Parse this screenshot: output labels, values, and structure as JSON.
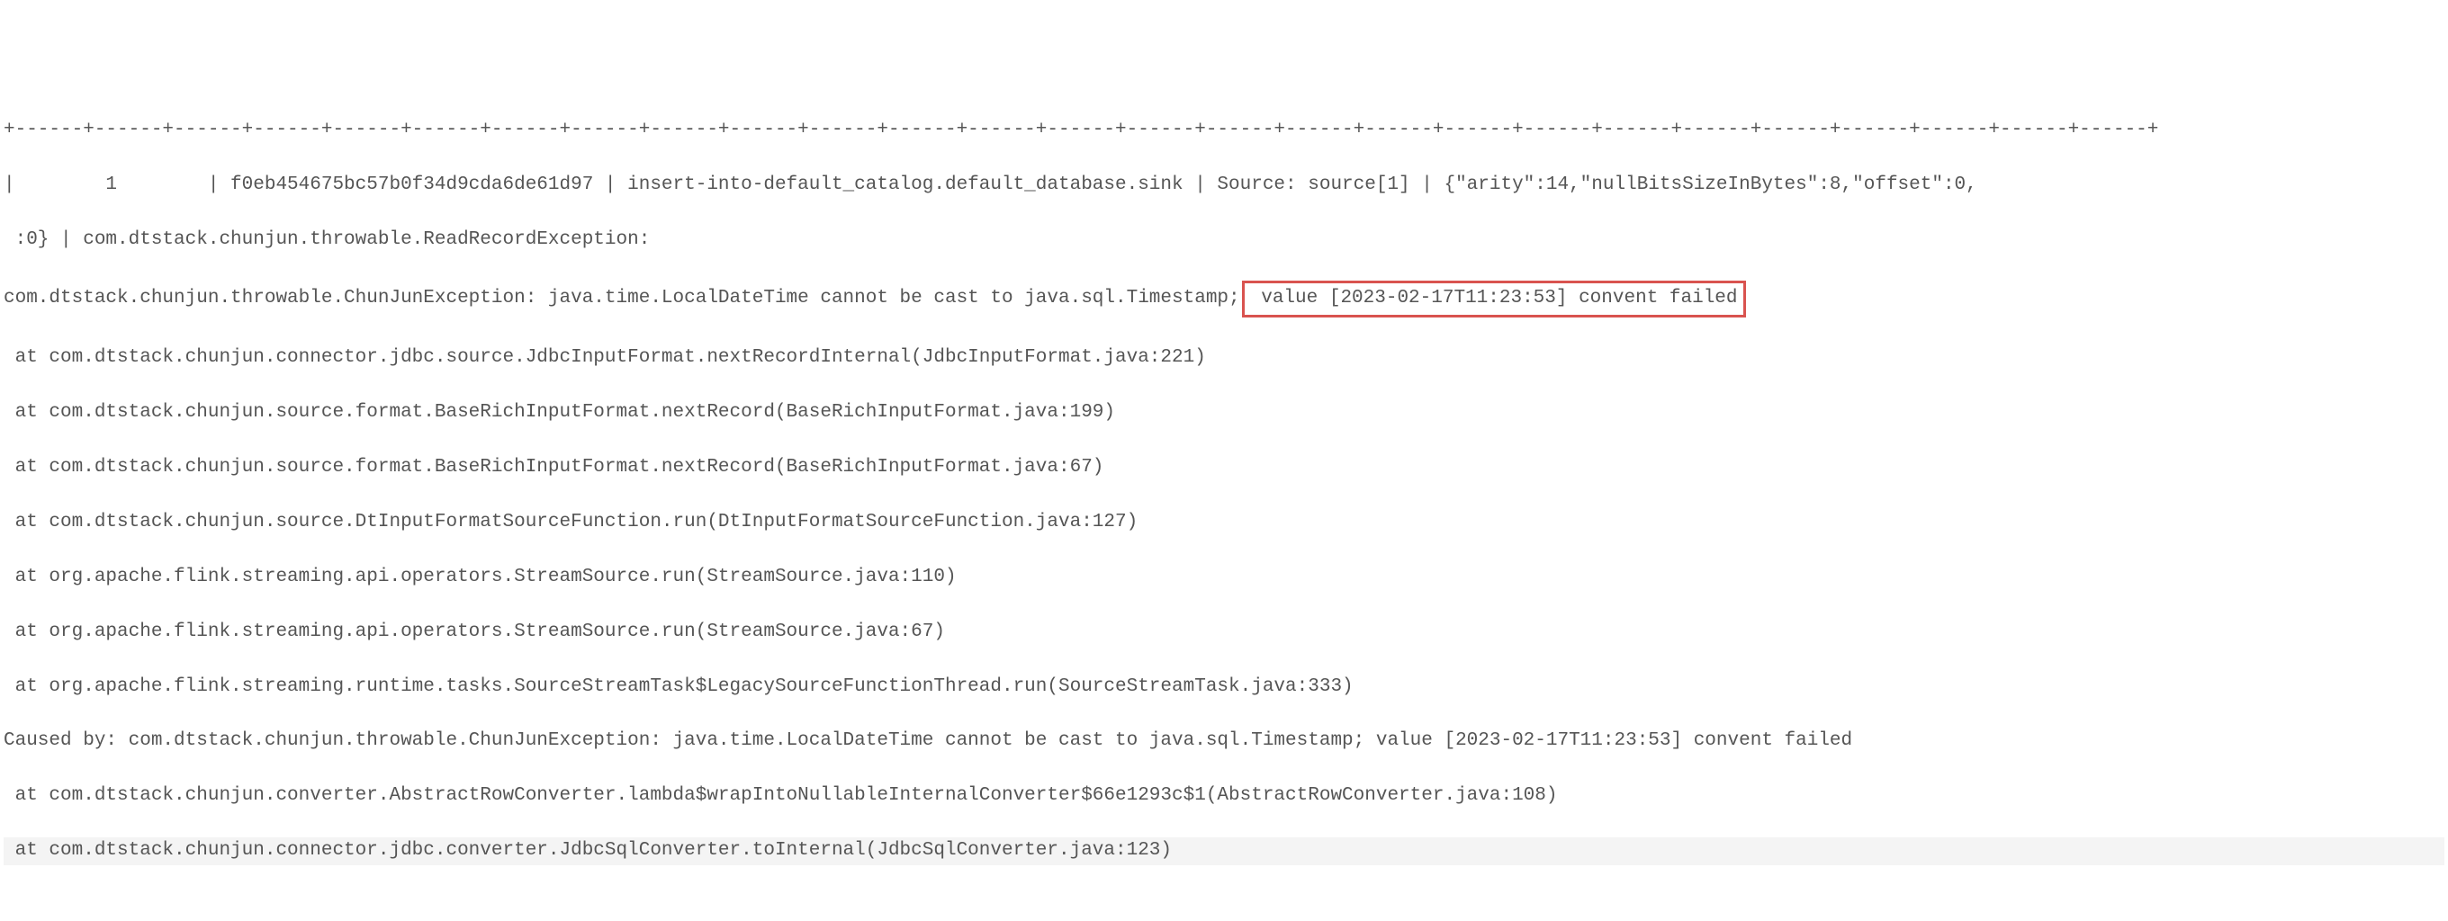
{
  "lines": {
    "l0": "+------+------+------+------+------+------+------+------+------+------+------+------+------+------+------+------+------+------+------+------+------+------+------+------+------+------+------+",
    "l1_a": "|        1        | f0eb454675bc57b0f34d9cda6de61d97 | insert-into-default_catalog.default_database.sink | Source: source[1] | {\"arity\":14,\"nullBitsSizeInBytes\":8,\"offset\":0,",
    "l2": " :0} | com.dtstack.chunjun.throwable.ReadRecordException:",
    "l3_a": "com.dtstack.chunjun.throwable.ChunJunException: java.time.LocalDateTime cannot be cast to java.sql.Timestamp;",
    "l3_box": " value [2023-02-17T11:23:53] convent failed",
    "l4": " at com.dtstack.chunjun.connector.jdbc.source.JdbcInputFormat.nextRecordInternal(JdbcInputFormat.java:221)",
    "l5": " at com.dtstack.chunjun.source.format.BaseRichInputFormat.nextRecord(BaseRichInputFormat.java:199)",
    "l6": " at com.dtstack.chunjun.source.format.BaseRichInputFormat.nextRecord(BaseRichInputFormat.java:67)",
    "l7": " at com.dtstack.chunjun.source.DtInputFormatSourceFunction.run(DtInputFormatSourceFunction.java:127)",
    "l8": " at org.apache.flink.streaming.api.operators.StreamSource.run(StreamSource.java:110)",
    "l9": " at org.apache.flink.streaming.api.operators.StreamSource.run(StreamSource.java:67)",
    "l10": " at org.apache.flink.streaming.runtime.tasks.SourceStreamTask$LegacySourceFunctionThread.run(SourceStreamTask.java:333)",
    "l11": "Caused by: com.dtstack.chunjun.throwable.ChunJunException: java.time.LocalDateTime cannot be cast to java.sql.Timestamp; value [2023-02-17T11:23:53] convent failed",
    "l12": " at com.dtstack.chunjun.converter.AbstractRowConverter.lambda$wrapIntoNullableInternalConverter$66e1293c$1(AbstractRowConverter.java:108)",
    "l13": " at com.dtstack.chunjun.connector.jdbc.converter.JdbcSqlConverter.toInternal(JdbcSqlConverter.java:123)"
  }
}
